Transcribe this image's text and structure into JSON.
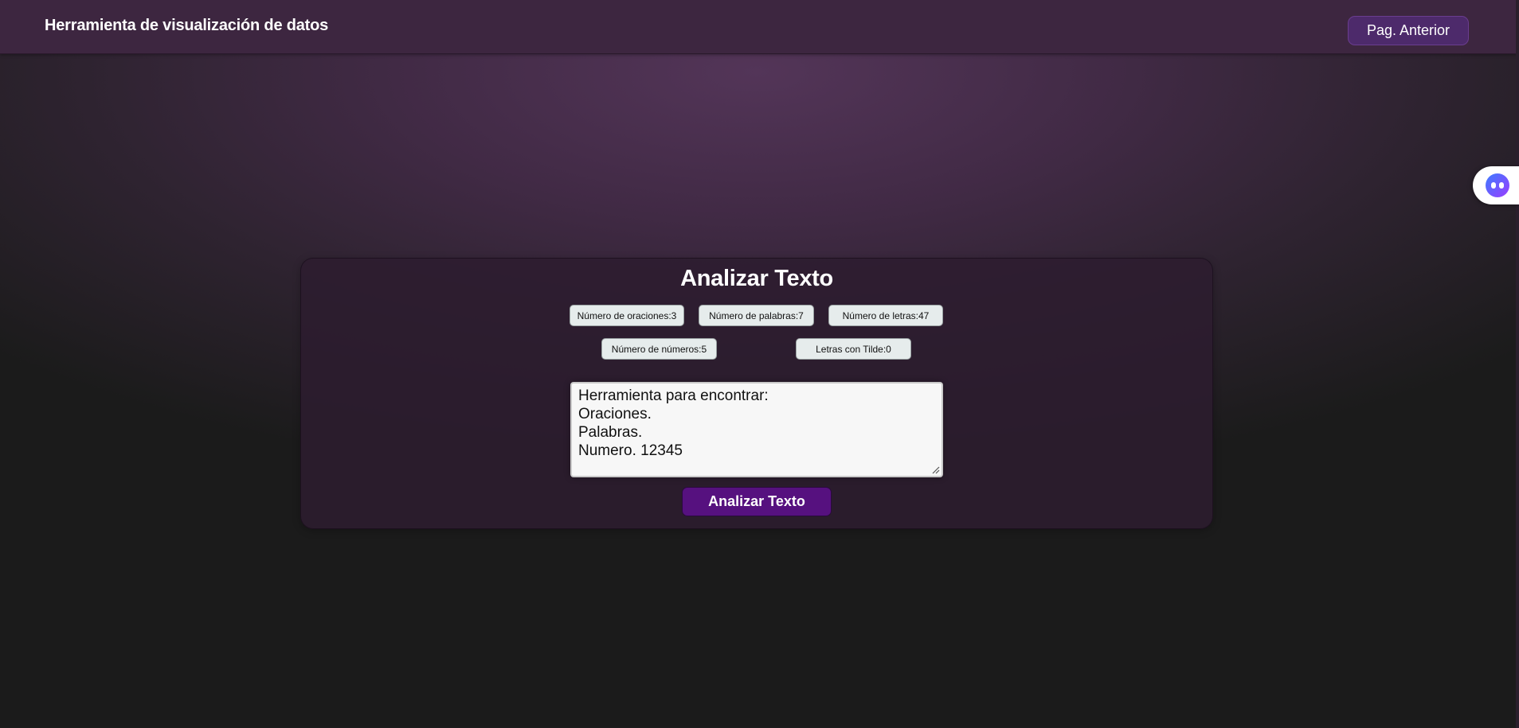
{
  "header": {
    "title": "Herramienta de visualización de datos",
    "back_button_label": "Pag. Anterior"
  },
  "widget": {
    "icon": "assistant-face-icon"
  },
  "analyzer": {
    "title": "Analizar Texto",
    "stats": {
      "oraciones": "Número de oraciones:3",
      "palabras": "Número de palabras:7",
      "letras": "Número de letras:47",
      "numeros": "Número de números:5",
      "tilde": "Letras con Tilde:0"
    },
    "input_text": "Herramienta para encontrar:\nOraciones.\nPalabras.\nNumero. 12345",
    "button_label": "Analizar Texto"
  },
  "colors": {
    "header_bg": "#3d2640",
    "button_accent": "#56117f",
    "back_button_bg": "#4d2a6b",
    "stat_bg": "#e6ecec"
  }
}
